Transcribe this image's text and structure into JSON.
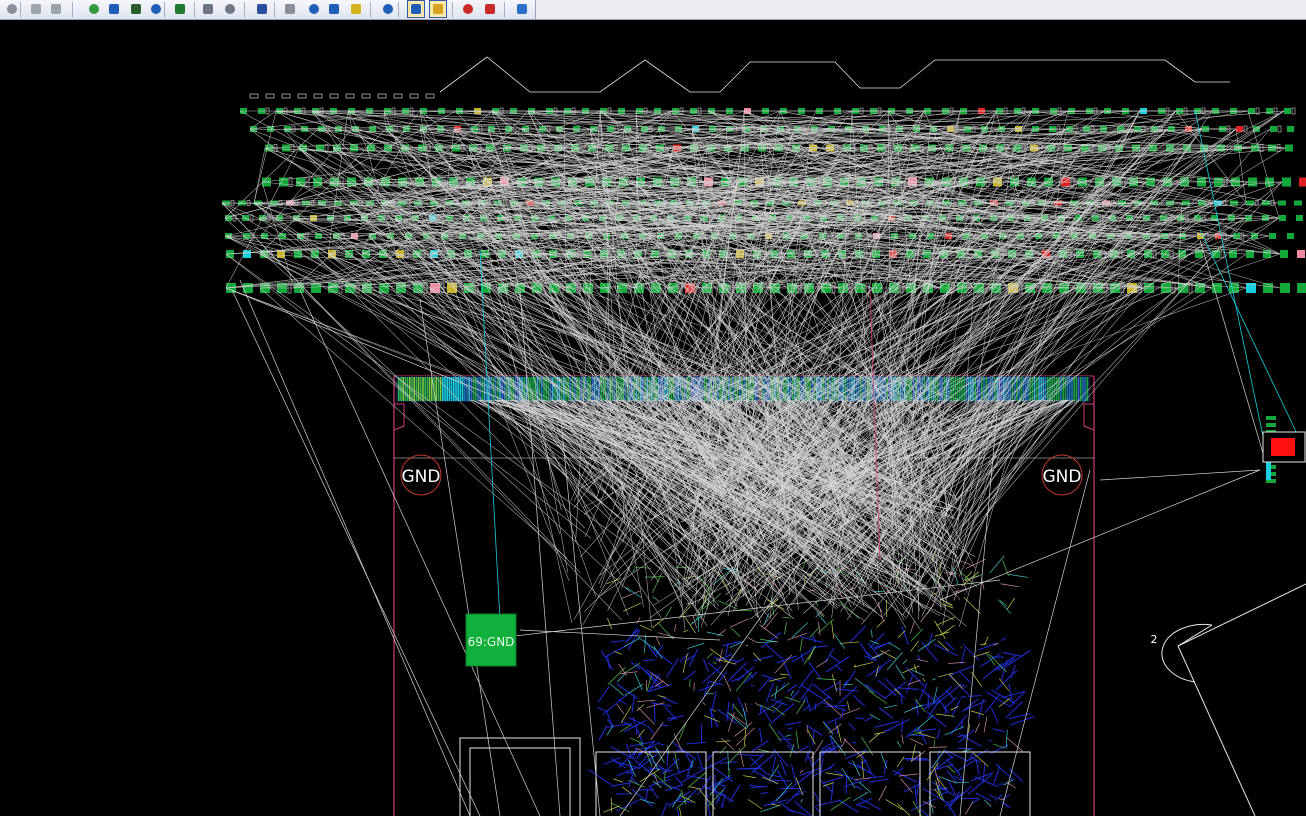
{
  "toolbar": {
    "tools": [
      {
        "name": "undo-tool-icon",
        "color": "#8a8f99"
      },
      {
        "name": "save-tool-icon",
        "color": "#9ea4ad"
      },
      {
        "name": "copy-tool-icon",
        "color": "#9ea4ad"
      },
      {
        "name": "route-tool-icon",
        "color": "#2f9b3a"
      },
      {
        "name": "grid-tool-icon",
        "color": "#1f5fb8"
      },
      {
        "name": "monitor-tool-icon",
        "color": "#2b5d2f"
      },
      {
        "name": "pen-tool-icon",
        "color": "#1f5fb8"
      },
      {
        "name": "snowflake-tool-icon",
        "color": "#1f7a2f"
      },
      {
        "name": "frame-tool-icon",
        "color": "#6f7684"
      },
      {
        "name": "frame-tool-2-icon",
        "color": "#6f7684"
      },
      {
        "name": "magnifier-icon",
        "color": "#2a4f9e"
      },
      {
        "name": "eraser-tool-icon",
        "color": "#8a8f99"
      },
      {
        "name": "select-tool-icon",
        "color": "#1f5fb8"
      },
      {
        "name": "refresh-tool-icon",
        "color": "#1f5fb8"
      },
      {
        "name": "diamond-tool-icon",
        "color": "#d6b21f"
      },
      {
        "name": "layer-tool-icon",
        "color": "#1f5fb8"
      },
      {
        "name": "highlight-tool-icon",
        "color": "#1f5fb8",
        "pressed": true
      },
      {
        "name": "paste-tool-icon",
        "color": "#d6a21f",
        "pressed": true
      },
      {
        "name": "zoom-out-icon",
        "color": "#cc2a2a"
      },
      {
        "name": "zoom-in-icon",
        "color": "#cc2a2a"
      },
      {
        "name": "chart-tool-icon",
        "color": "#2a6fc8"
      }
    ]
  },
  "canvas": {
    "background": "#000000",
    "labels": {
      "gnd_left": "GND",
      "gnd_right": "GND",
      "component": "69:GND",
      "board_mark": "2"
    },
    "colors": {
      "ratsnest": "#d4d4d4",
      "outline_pink": "#d23c7a",
      "pad_green": "#12a83a",
      "pad_cyan": "#19d0e0",
      "pad_pink": "#f08aa0",
      "pad_red": "#e02020",
      "trace_blue": "#1f2fd8",
      "trace_yellow": "#c9c94a",
      "highlight_red": "#ff1010",
      "line_white": "#e8e8e8"
    }
  }
}
